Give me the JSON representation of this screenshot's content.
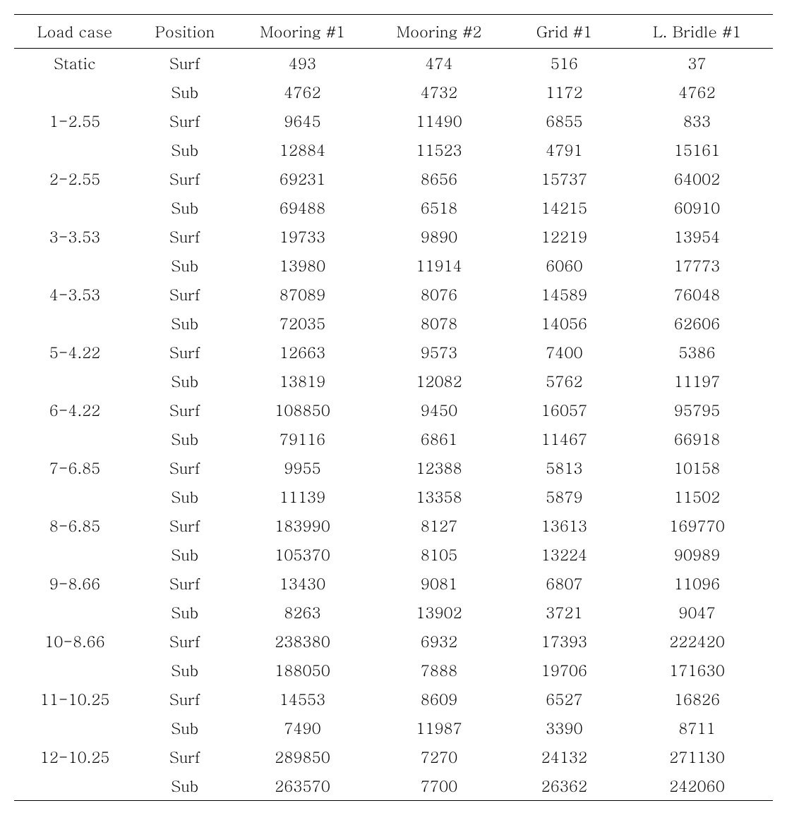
{
  "table": {
    "headers": [
      "Load case",
      "Position",
      "Mooring #1",
      "Mooring #2",
      "Grid #1",
      "L. Bridle #1"
    ],
    "rows": [
      {
        "load_case": "Static",
        "position": "Surf",
        "m1": "493",
        "m2": "474",
        "g1": "516",
        "lb": "37"
      },
      {
        "load_case": "",
        "position": "Sub",
        "m1": "4762",
        "m2": "4732",
        "g1": "1172",
        "lb": "4762"
      },
      {
        "load_case": "1-2.55",
        "position": "Surf",
        "m1": "9645",
        "m2": "11490",
        "g1": "6855",
        "lb": "833"
      },
      {
        "load_case": "",
        "position": "Sub",
        "m1": "12884",
        "m2": "11523",
        "g1": "4791",
        "lb": "15161"
      },
      {
        "load_case": "2-2.55",
        "position": "Surf",
        "m1": "69231",
        "m2": "8656",
        "g1": "15737",
        "lb": "64002"
      },
      {
        "load_case": "",
        "position": "Sub",
        "m1": "69488",
        "m2": "6518",
        "g1": "14215",
        "lb": "60910"
      },
      {
        "load_case": "3-3.53",
        "position": "Surf",
        "m1": "19733",
        "m2": "9890",
        "g1": "12219",
        "lb": "13954"
      },
      {
        "load_case": "",
        "position": "Sub",
        "m1": "13980",
        "m2": "11914",
        "g1": "6060",
        "lb": "17773"
      },
      {
        "load_case": "4-3.53",
        "position": "Surf",
        "m1": "87089",
        "m2": "8076",
        "g1": "14589",
        "lb": "76048"
      },
      {
        "load_case": "",
        "position": "Sub",
        "m1": "72035",
        "m2": "8078",
        "g1": "14056",
        "lb": "62606"
      },
      {
        "load_case": "5-4.22",
        "position": "Surf",
        "m1": "12663",
        "m2": "9573",
        "g1": "7400",
        "lb": "5386"
      },
      {
        "load_case": "",
        "position": "Sub",
        "m1": "13819",
        "m2": "12082",
        "g1": "5762",
        "lb": "11197"
      },
      {
        "load_case": "6-4.22",
        "position": "Surf",
        "m1": "108850",
        "m2": "9450",
        "g1": "16057",
        "lb": "95795"
      },
      {
        "load_case": "",
        "position": "Sub",
        "m1": "79116",
        "m2": "6861",
        "g1": "11467",
        "lb": "66918"
      },
      {
        "load_case": "7-6.85",
        "position": "Surf",
        "m1": "9955",
        "m2": "12388",
        "g1": "5813",
        "lb": "10158"
      },
      {
        "load_case": "",
        "position": "Sub",
        "m1": "11139",
        "m2": "13358",
        "g1": "5879",
        "lb": "11502"
      },
      {
        "load_case": "8-6.85",
        "position": "Surf",
        "m1": "183990",
        "m2": "8127",
        "g1": "13613",
        "lb": "169770"
      },
      {
        "load_case": "",
        "position": "Sub",
        "m1": "105370",
        "m2": "8105",
        "g1": "13224",
        "lb": "90989"
      },
      {
        "load_case": "9-8.66",
        "position": "Surf",
        "m1": "13430",
        "m2": "9081",
        "g1": "6807",
        "lb": "11096"
      },
      {
        "load_case": "",
        "position": "Sub",
        "m1": "8263",
        "m2": "13902",
        "g1": "3721",
        "lb": "9047"
      },
      {
        "load_case": "10-8.66",
        "position": "Surf",
        "m1": "238380",
        "m2": "6932",
        "g1": "17393",
        "lb": "222420"
      },
      {
        "load_case": "",
        "position": "Sub",
        "m1": "188050",
        "m2": "7888",
        "g1": "19706",
        "lb": "171630"
      },
      {
        "load_case": "11-10.25",
        "position": "Surf",
        "m1": "14553",
        "m2": "8609",
        "g1": "6527",
        "lb": "16826"
      },
      {
        "load_case": "",
        "position": "Sub",
        "m1": "7490",
        "m2": "11987",
        "g1": "3390",
        "lb": "8711"
      },
      {
        "load_case": "12-10.25",
        "position": "Surf",
        "m1": "289850",
        "m2": "7270",
        "g1": "24132",
        "lb": "271130"
      },
      {
        "load_case": "",
        "position": "Sub",
        "m1": "263570",
        "m2": "7700",
        "g1": "26362",
        "lb": "242060"
      }
    ]
  }
}
